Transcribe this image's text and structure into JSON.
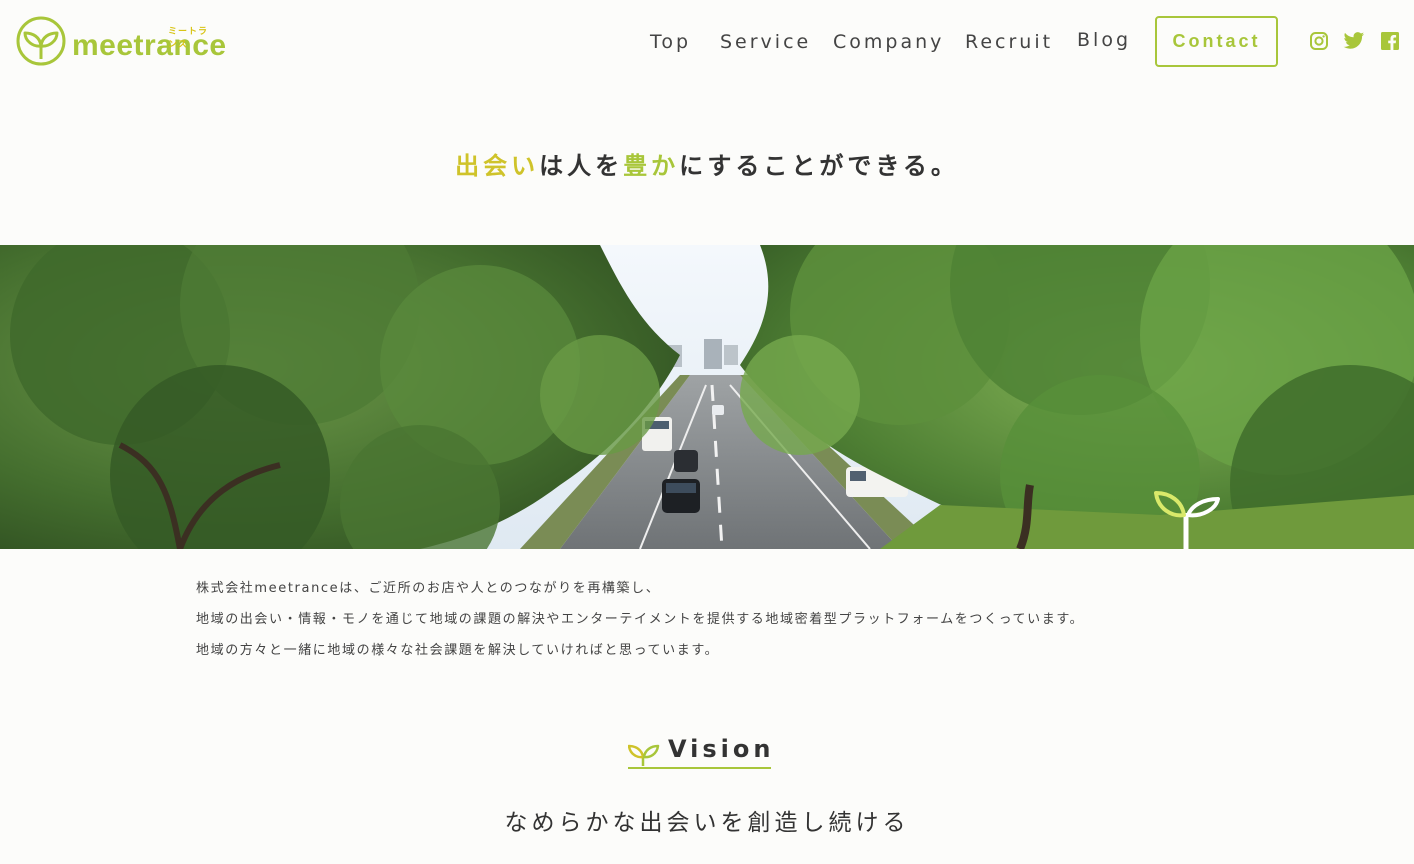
{
  "brand": {
    "name": "meetrance",
    "kana": "ミートランス",
    "accent_color": "#a8c63a",
    "accent_yellow": "#cfc32a",
    "logo_icon": "sprout-icon"
  },
  "nav": {
    "items": [
      {
        "label": "Top"
      },
      {
        "label": "Service"
      },
      {
        "label": "Company"
      },
      {
        "label": "Recruit"
      },
      {
        "label": "Blog"
      }
    ],
    "contact_label": "Contact"
  },
  "social": [
    {
      "name": "instagram-icon"
    },
    {
      "name": "twitter-icon"
    },
    {
      "name": "facebook-icon"
    }
  ],
  "tagline": {
    "part1": "出会い",
    "part2": "は人を",
    "part3": "豊か",
    "part4": "にすることができる。"
  },
  "hero": {
    "description": "Tree-lined boulevard photograph with sprout icon"
  },
  "intro": {
    "lines": [
      "株式会社meetranceは、ご近所のお店や人とのつながりを再構築し、",
      "地域の出会い・情報・モノを通じて地域の課題の解決やエンターテイメントを提供する地域密着型プラットフォームをつくっています。",
      "地域の方々と一緒に地域の様々な社会課題を解決していければと思っています。"
    ]
  },
  "vision": {
    "title": "Vision",
    "subtitle": "なめらかな出会いを創造し続ける"
  }
}
